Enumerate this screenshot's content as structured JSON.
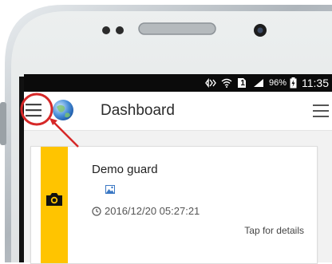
{
  "status_bar": {
    "battery_percent": "96%",
    "sim_slot": "1",
    "time": "11:35",
    "icons": [
      "nfc-icon",
      "wifi-icon",
      "sim-icon",
      "signal-icon",
      "battery-icon"
    ]
  },
  "app_bar": {
    "title": "Dashboard",
    "left_icon": "hamburger-menu-icon",
    "logo_icon": "globe-logo-icon",
    "right_icon": "overflow-menu-icon"
  },
  "card": {
    "title": "Demo guard",
    "timestamp": "2016/12/20 05:27:21",
    "tap_hint": "Tap for details",
    "icons": [
      "camera-icon",
      "image-icon",
      "clock-icon"
    ]
  },
  "colors": {
    "stripe": "#ffc400",
    "highlight_ring": "#d62828",
    "status_bar": "#0b0b0b"
  }
}
